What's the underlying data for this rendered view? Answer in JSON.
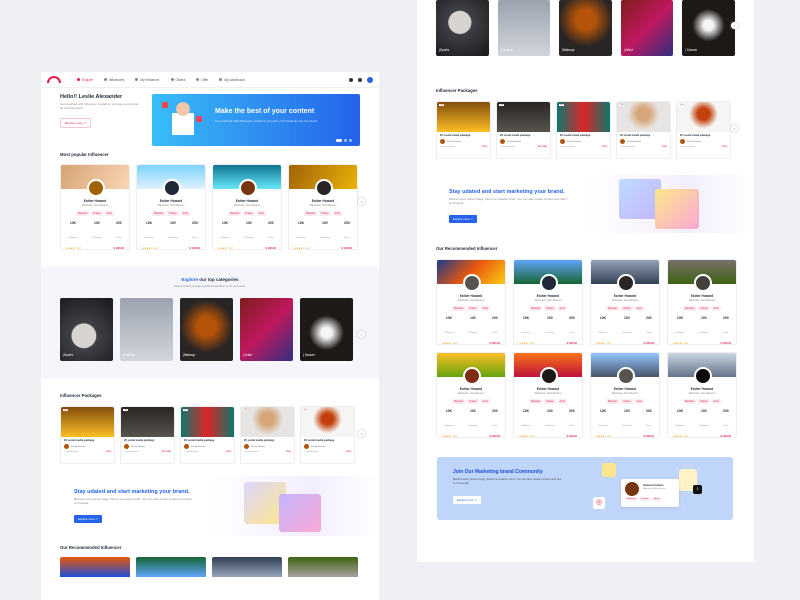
{
  "nav": {
    "items": [
      {
        "label": "Explore",
        "active": true
      },
      {
        "label": "Influencers",
        "active": false
      },
      {
        "label": "My Influencer",
        "active": false
      },
      {
        "label": "Orders",
        "active": false
      },
      {
        "label": "Offer",
        "active": false
      },
      {
        "label": "My dashboard",
        "active": false
      }
    ]
  },
  "hero": {
    "greeting": "Hello!!  Leslie Alexander",
    "subtitle": "Get matched with influencer models to promote your brand all over the world.",
    "button": "Explore more ↗",
    "banner_title": "Make the best of your content",
    "banner_subtitle": "Get matched with influencer models to promote your brand all over the world."
  },
  "popular": {
    "title": "Most popular Influencer",
    "cards": [
      {
        "name": "Esther Howard",
        "location": "Allentown, New Mexico",
        "chips": [
          "Musician",
          "Drama",
          "Actor"
        ],
        "stats": [
          {
            "v": "10K",
            "l": "Followers"
          },
          {
            "v": "100",
            "l": "Following"
          },
          {
            "v": "200",
            "l": "Posts"
          }
        ],
        "rating": "★★★★☆ 4.0",
        "price": "$ 1100.00"
      },
      {
        "name": "Esther Howard",
        "location": "Allentown, New Mexico",
        "chips": [
          "Musician",
          "Drama",
          "Actor"
        ],
        "stats": [
          {
            "v": "10K",
            "l": "Followers"
          },
          {
            "v": "100",
            "l": "Following"
          },
          {
            "v": "200",
            "l": "Posts"
          }
        ],
        "rating": "★★★★☆ 4.0",
        "price": "$ 1100.00"
      },
      {
        "name": "Esther Howard",
        "location": "Allentown, New Mexico",
        "chips": [
          "Musician",
          "Drama",
          "Actor"
        ],
        "stats": [
          {
            "v": "10K",
            "l": "Followers"
          },
          {
            "v": "100",
            "l": "Following"
          },
          {
            "v": "200",
            "l": "Posts"
          }
        ],
        "rating": "★★★★☆ 4.0",
        "price": "$ 1100.00"
      },
      {
        "name": "Esther Howard",
        "location": "Allentown, New Mexico",
        "chips": [
          "Musician",
          "Drama",
          "Actor"
        ],
        "stats": [
          {
            "v": "10K",
            "l": "Followers"
          },
          {
            "v": "100",
            "l": "Following"
          },
          {
            "v": "200",
            "l": "Posts"
          }
        ],
        "rating": "★★★★☆ 4.0",
        "price": "$ 1100.00"
      }
    ]
  },
  "categories": {
    "title_highlight": "Explore",
    "title_rest": " our top categories",
    "subtitle": "Check what's popular and find inspiration to hit your work.",
    "items": [
      "|Sports",
      "|Fashion",
      "|Makeup",
      "| Artist",
      "| Dancer"
    ]
  },
  "packages": {
    "title": "Influencer Packages",
    "items": [
      {
        "tag": "Top",
        "title": "20 social media package",
        "author": "Kristin Watson",
        "footer": "1 related photo",
        "price": "$121"
      },
      {
        "tag": "Top",
        "title": "20 social media package",
        "author": "Kristin Watson",
        "footer": "1 related photo",
        "price": "$121.887"
      },
      {
        "tag": "Top",
        "title": "20 social media package",
        "author": "Kristin Watson",
        "footer": "1 related photo",
        "price": "$121"
      },
      {
        "tag": "Top",
        "title": "20 social media package",
        "author": "Kristin Watson",
        "footer": "1 related photo",
        "price": "$121"
      },
      {
        "tag": "Top",
        "title": "20 social media package",
        "author": "Kristin Watson",
        "footer": "1 related photo",
        "price": "$121"
      }
    ]
  },
  "promo": {
    "title": "Stay udated and start marketing your brand.",
    "subtitle": "Behind every stock image, there's a creative mind. You can also create content and sell it on Freepik.",
    "button": "Explore more ↗"
  },
  "recommended": {
    "title": "Our Recommended Influencer",
    "cards": [
      {
        "name": "Esther Howard",
        "location": "Allentown, New Mexico",
        "chips": [
          "Musician",
          "Drama",
          "Actor"
        ],
        "stats": [
          {
            "v": "10K",
            "l": "Followers"
          },
          {
            "v": "100",
            "l": "Following"
          },
          {
            "v": "200",
            "l": "Posts"
          }
        ],
        "rating": "★★★★☆ 4.0",
        "price": "$ 1100.00"
      },
      {
        "name": "Esther Howard",
        "location": "Allentown, New Mexico",
        "chips": [
          "Musician",
          "Drama",
          "Actor"
        ],
        "stats": [
          {
            "v": "10K",
            "l": "Followers"
          },
          {
            "v": "100",
            "l": "Following"
          },
          {
            "v": "200",
            "l": "Posts"
          }
        ],
        "rating": "★★★★☆ 4.0",
        "price": "$ 1100.00"
      },
      {
        "name": "Esther Howard",
        "location": "Allentown, New Mexico",
        "chips": [
          "Musician",
          "Drama",
          "Actor"
        ],
        "stats": [
          {
            "v": "10K",
            "l": "Followers"
          },
          {
            "v": "100",
            "l": "Following"
          },
          {
            "v": "200",
            "l": "Posts"
          }
        ],
        "rating": "★★★★☆ 4.0",
        "price": "$ 1100.00"
      },
      {
        "name": "Esther Howard",
        "location": "Allentown, New Mexico",
        "chips": [
          "Musician",
          "Drama",
          "Actor"
        ],
        "stats": [
          {
            "v": "10K",
            "l": "Followers"
          },
          {
            "v": "100",
            "l": "Following"
          },
          {
            "v": "200",
            "l": "Posts"
          }
        ],
        "rating": "★★★★☆ 4.0",
        "price": "$ 1100.00"
      },
      {
        "name": "Esther Howard",
        "location": "Allentown, New Mexico",
        "chips": [
          "Musician",
          "Drama",
          "Actor"
        ],
        "stats": [
          {
            "v": "10K",
            "l": "Followers"
          },
          {
            "v": "100",
            "l": "Following"
          },
          {
            "v": "200",
            "l": "Posts"
          }
        ],
        "rating": "★★★★☆ 4.0",
        "price": "$ 1100.00"
      },
      {
        "name": "Esther Howard",
        "location": "Allentown, New Mexico",
        "chips": [
          "Musician",
          "Drama",
          "Actor"
        ],
        "stats": [
          {
            "v": "10K",
            "l": "Followers"
          },
          {
            "v": "100",
            "l": "Following"
          },
          {
            "v": "200",
            "l": "Posts"
          }
        ],
        "rating": "★★★★☆ 4.0",
        "price": "$ 1100.00"
      },
      {
        "name": "Esther Howard",
        "location": "Allentown, New Mexico",
        "chips": [
          "Musician",
          "Drama",
          "Actor"
        ],
        "stats": [
          {
            "v": "10K",
            "l": "Followers"
          },
          {
            "v": "100",
            "l": "Following"
          },
          {
            "v": "200",
            "l": "Posts"
          }
        ],
        "rating": "★★★★☆ 4.0",
        "price": "$ 1100.00"
      },
      {
        "name": "Esther Howard",
        "location": "Allentown, New Mexico",
        "chips": [
          "Musician",
          "Drama",
          "Actor"
        ],
        "stats": [
          {
            "v": "10K",
            "l": "Followers"
          },
          {
            "v": "100",
            "l": "Following"
          },
          {
            "v": "200",
            "l": "Posts"
          }
        ],
        "rating": "★★★★☆ 4.0",
        "price": "$ 1100.00"
      }
    ]
  },
  "community": {
    "title": "Join Our Marketing brand Community",
    "subtitle": "Behind every stock image, there's a creative mind. You can also create content and sell it on Freepik.",
    "button": "Explore more ↗",
    "profile_name": "Selena Gomez",
    "profile_location": "Allentown, New Mexico",
    "profile_chips": [
      "Musician",
      "Drama",
      "Actor"
    ]
  },
  "colors": {
    "accent": "#e11d48",
    "brand": "#2563eb"
  }
}
